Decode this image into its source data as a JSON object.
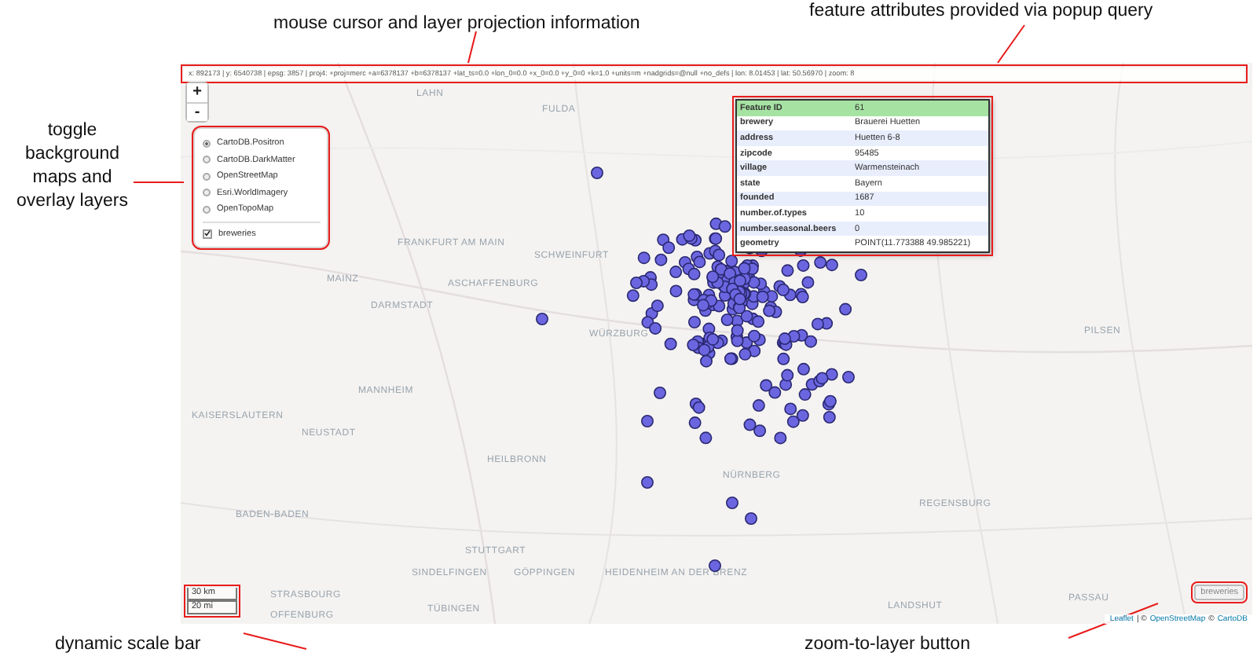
{
  "annotations": [
    {
      "text": "mouse cursor and layer projection information"
    },
    {
      "text": "feature attributes provided via popup query"
    },
    {
      "text": "toggle background maps and overlay layers"
    },
    {
      "text": "dynamic scale bar"
    },
    {
      "text": "zoom-to-layer button"
    }
  ],
  "infobar": {
    "text": "x: 892173 | y: 6540738 | epsg: 3857 | proj4: +proj=merc +a=6378137 +b=6378137 +lat_ts=0.0 +lon_0=0.0 +x_0=0.0 +y_0=0 +k=1.0 +units=m +nadgrids=@null +no_defs | lon: 8.01453 | lat: 50.56970 | zoom: 8"
  },
  "zoom_controls": [
    "+",
    "-"
  ],
  "layers": {
    "base": [
      {
        "label": "CartoDB.Positron",
        "selected": true
      },
      {
        "label": "CartoDB.DarkMatter",
        "selected": false
      },
      {
        "label": "OpenStreetMap",
        "selected": false
      },
      {
        "label": "Esri.WorldImagery",
        "selected": false
      },
      {
        "label": "OpenTopoMap",
        "selected": false
      }
    ],
    "overlays": [
      {
        "label": "breweries",
        "checked": true
      }
    ]
  },
  "popup": {
    "rows": [
      {
        "key": "Feature ID",
        "value": "61",
        "highlighted": true
      },
      {
        "key": "brewery",
        "value": "Brauerei Huetten",
        "highlighted": false
      },
      {
        "key": "address",
        "value": "Huetten 6-8",
        "highlighted": false
      },
      {
        "key": "zipcode",
        "value": "95485",
        "highlighted": false
      },
      {
        "key": "village",
        "value": "Warmensteinach",
        "highlighted": false
      },
      {
        "key": "state",
        "value": "Bayern",
        "highlighted": false
      },
      {
        "key": "founded",
        "value": "1687",
        "highlighted": false
      },
      {
        "key": "number.of.types",
        "value": "10",
        "highlighted": false
      },
      {
        "key": "number.seasonal.beers",
        "value": "0",
        "highlighted": false
      },
      {
        "key": "geometry",
        "value": "POINT(11.773388 49.985221)",
        "highlighted": false
      }
    ]
  },
  "places": [
    "LAHN",
    "FULDA",
    "FRANKFURT AM MAIN",
    "MAINZ",
    "DARMSTADT",
    "ASCHAFFENBURG",
    "SCHWEINFURT",
    "WÜRZBURG",
    "MANNHEIM",
    "KAISERSLAUTERN",
    "NEUSTADT",
    "HEILBRONN",
    "NÜRNBERG",
    "PILSEN",
    "REGENSBURG",
    "BADEN-BADEN",
    "STUTTGART",
    "SINDELFINGEN",
    "GÖPPINGEN",
    "HEIDENHEIM AN DER BRENZ",
    "STRASBOURG",
    "OFFENBURG",
    "TÜBINGEN",
    "LANDSHUT",
    "PASSAU"
  ],
  "scale": [
    "30 km",
    "20 mi"
  ],
  "zoom_to_layer": "breweries",
  "attribution": [
    {
      "text": "Leaflet",
      "link": true
    },
    {
      "text": "| ©",
      "link": false
    },
    {
      "text": "OpenStreetMap",
      "link": true
    },
    {
      "text": "©",
      "link": false
    },
    {
      "text": "CartoDB",
      "link": true
    }
  ]
}
